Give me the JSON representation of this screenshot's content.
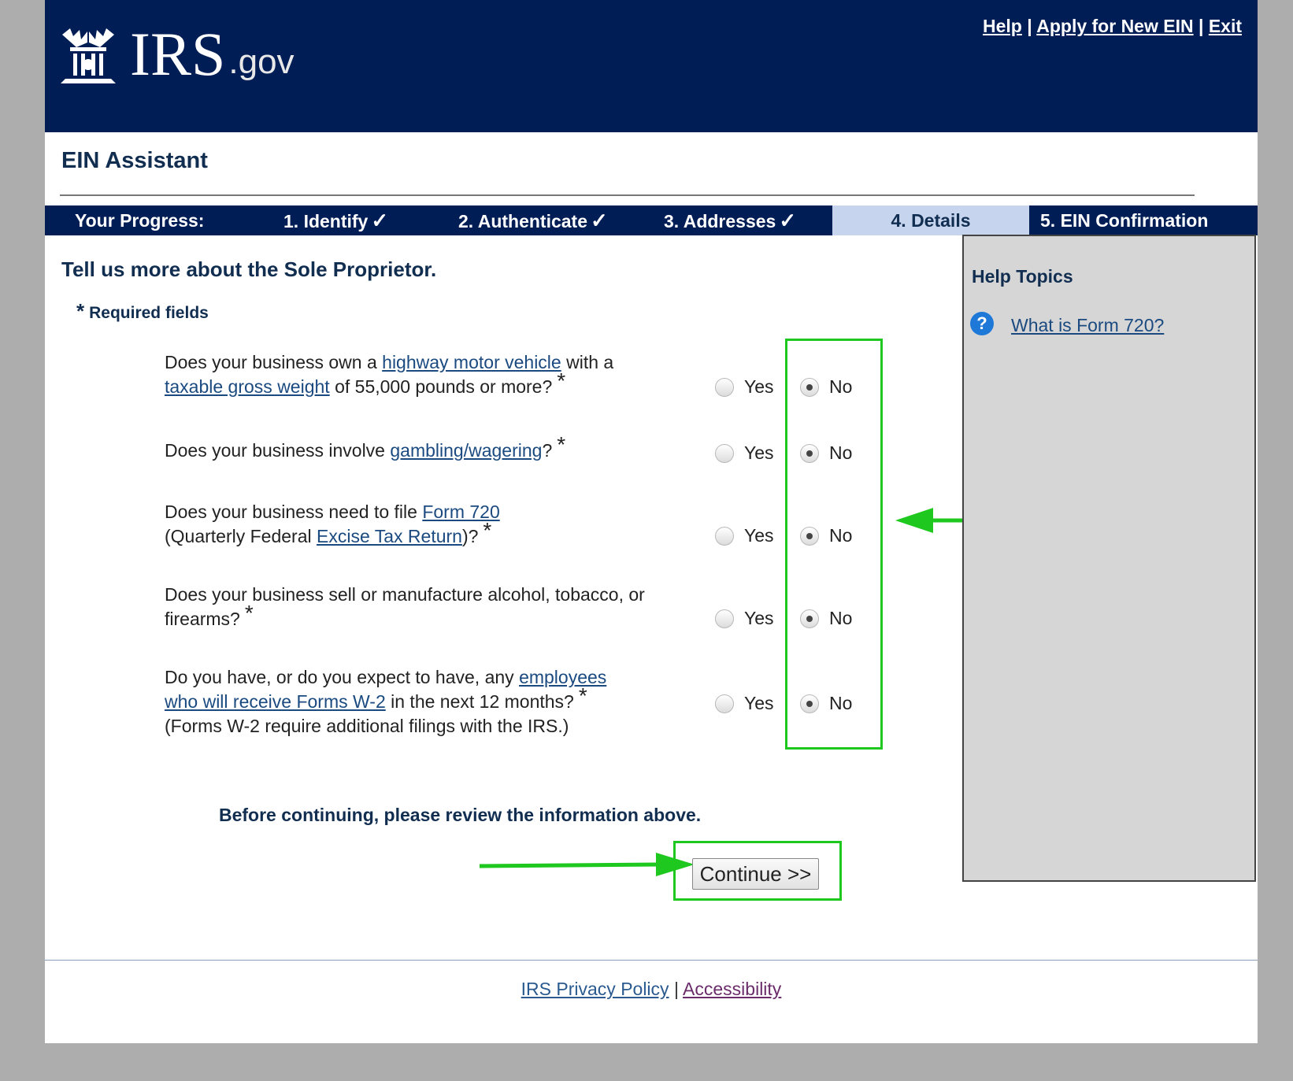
{
  "header": {
    "logo_text": "IRS",
    "logo_suffix": ".gov",
    "links": {
      "help": "Help",
      "apply": "Apply for New EIN",
      "exit": "Exit",
      "separator": "|"
    }
  },
  "app_title": "EIN Assistant",
  "progress": {
    "label": "Your Progress:",
    "steps": [
      {
        "label": "1. Identify",
        "complete": true
      },
      {
        "label": "2. Authenticate",
        "complete": true
      },
      {
        "label": "3. Addresses",
        "complete": true
      },
      {
        "label": "4. Details",
        "active": true
      },
      {
        "label": "5. EIN Confirmation"
      }
    ],
    "check": "✓"
  },
  "main": {
    "heading": "Tell us more about the Sole Proprietor.",
    "required_star": "*",
    "required_label": "Required fields",
    "questions": [
      {
        "t1": "Does your business own a ",
        "l1": "highway motor vehicle",
        "t2": " with a",
        "l2": "taxable gross weight",
        "t3": " of 55,000 pounds or more?",
        "answer": "No"
      },
      {
        "t1": "Does your business involve ",
        "l1": "gambling/wagering",
        "t2": "?",
        "answer": "No"
      },
      {
        "t1": "Does your business need to file ",
        "l1": "Form 720",
        "t2": "(Quarterly Federal ",
        "l2": "Excise Tax Return",
        "t3": ")?",
        "answer": "No"
      },
      {
        "t1": "Does your business sell or manufacture alcohol, tobacco, or",
        "t2": "firearms?",
        "answer": "No"
      },
      {
        "t1": "Do you have, or do you expect to have, any ",
        "l1": "employees",
        "l2": "who will receive Forms W-2",
        "t2": " in the next 12 months?",
        "t3": "(Forms W-2 require additional filings with the IRS.)",
        "answer": "No"
      }
    ],
    "option_yes": "Yes",
    "option_no": "No",
    "req_star": "*",
    "review_text": "Before continuing, please review the information above.",
    "continue_label": "Continue >>"
  },
  "sidebar": {
    "title": "Help Topics",
    "help_icon": "?",
    "links": [
      "What is Form 720?"
    ]
  },
  "footer": {
    "privacy": "IRS Privacy Policy",
    "separator": "|",
    "accessibility": "Accessibility"
  },
  "colors": {
    "navy": "#001d55",
    "heading": "#112e51",
    "active_step": "#c6d4ee",
    "annotation_green": "#1ec81e",
    "sidebar_bg": "#d6d6d6"
  }
}
